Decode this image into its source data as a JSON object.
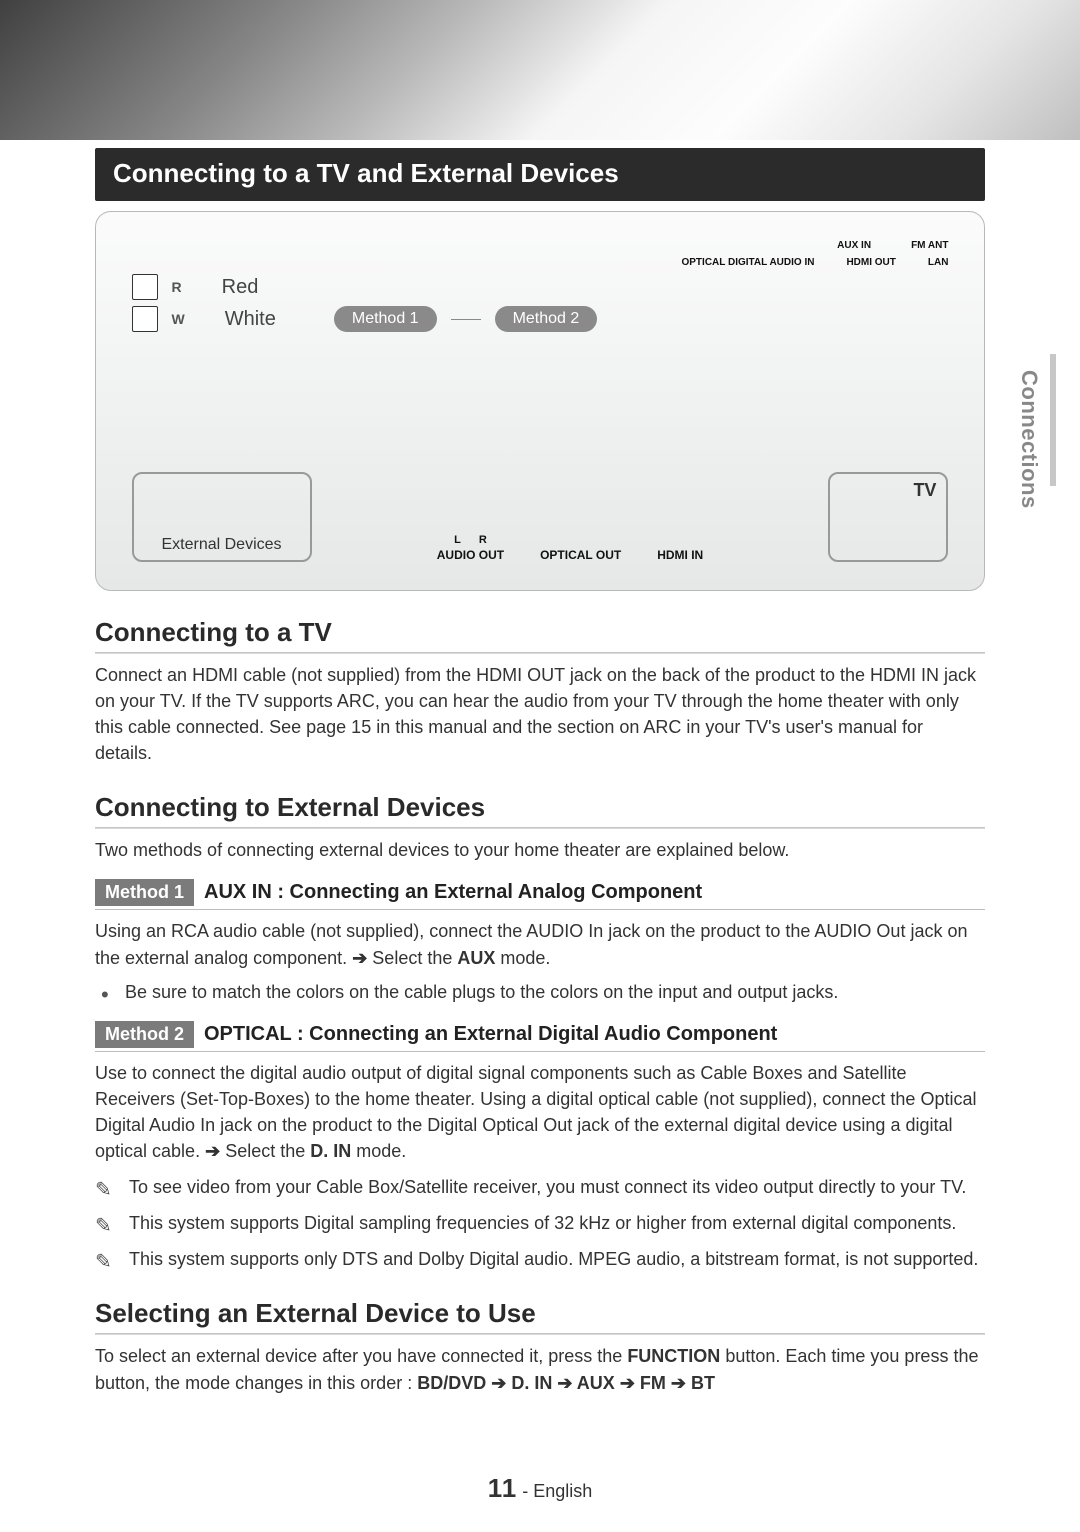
{
  "side_tab": "Connections",
  "title": "Connecting to a TV and External Devices",
  "diagram": {
    "red": "Red",
    "white": "White",
    "method1": "Method 1",
    "method2": "Method 2",
    "ext_devices": "External Devices",
    "tv": "TV",
    "aux_in": "AUX IN",
    "fm_ant": "FM ANT",
    "optical_in": "OPTICAL DIGITAL AUDIO IN",
    "hdmi_out": "HDMI OUT",
    "lan": "LAN",
    "audio_out": "AUDIO OUT",
    "optical_out": "OPTICAL OUT",
    "hdmi_in": "HDMI IN",
    "r": "R",
    "w": "W",
    "l_label": "L",
    "r_label": "R"
  },
  "sections": {
    "tv": {
      "heading": "Connecting to a TV",
      "body": "Connect an HDMI cable (not supplied) from the HDMI OUT jack on the back of the product to the HDMI IN jack on your TV. If the TV supports ARC, you can hear the audio from your TV through the home theater with only this cable connected. See page 15 in this manual and the section on ARC in your TV's user's manual for details."
    },
    "ext": {
      "heading": "Connecting to External Devices",
      "intro": "Two methods of connecting external devices to your home theater are explained below."
    },
    "m1": {
      "badge": "Method 1",
      "title": "AUX IN : Connecting an External Analog Component",
      "body_a": "Using an RCA audio cable (not supplied), connect the AUDIO In jack on the product to the AUDIO Out jack on the external analog component. ",
      "select": " Select the ",
      "mode": "AUX",
      "mode_suffix": " mode.",
      "bullet1": "Be sure to match the colors on the cable plugs to the colors on the input and output jacks."
    },
    "m2": {
      "badge": "Method 2",
      "title": "OPTICAL : Connecting an External Digital Audio Component",
      "body_a": "Use to connect the digital audio output of digital signal components such as Cable Boxes and Satellite Receivers (Set-Top-Boxes) to the home theater. Using a digital optical cable (not supplied), connect the Optical Digital Audio In jack on the product to the Digital Optical Out jack of the external digital device using a digital optical cable. ",
      "select": " Select the ",
      "mode": "D. IN",
      "mode_suffix": " mode.",
      "note1": "To see video from your Cable Box/Satellite receiver, you must connect its video output directly to your TV.",
      "note2": "This system supports Digital sampling frequencies of 32 kHz or higher from external digital components.",
      "note3": "This system supports only DTS and Dolby Digital audio. MPEG audio, a bitstream format, is not supported."
    },
    "sel": {
      "heading": "Selecting an External Device to Use",
      "body_a": "To select an external device after you have connected it, press the ",
      "func": "FUNCTION",
      "body_b": " button. Each time you press the button, the mode changes in this order : ",
      "seq1": "BD/DVD",
      "seq2": "D. IN",
      "seq3": "AUX",
      "seq4": "FM",
      "seq5": "BT"
    }
  },
  "footer": {
    "page_num": "11",
    "sep": " - ",
    "lang": "English"
  },
  "symbols": {
    "arrow": "➔",
    "note": "✎"
  }
}
